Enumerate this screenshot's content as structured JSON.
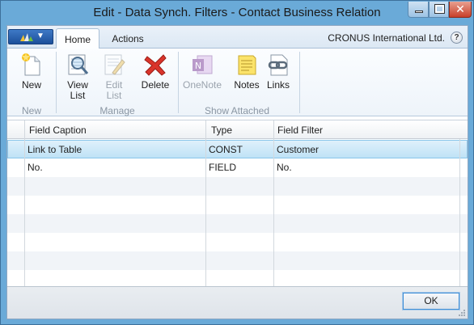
{
  "window": {
    "title": "Edit - Data Synch. Filters - Contact Business Relation"
  },
  "ribbon_tabs": [
    {
      "label": "Home"
    },
    {
      "label": "Actions"
    }
  ],
  "company": "CRONUS International Ltd.",
  "help_label": "?",
  "ribbon": {
    "new_group": {
      "label": "New",
      "new_label": "New"
    },
    "manage_group": {
      "label": "Manage",
      "view_list_label": "View\nList",
      "edit_list_label": "Edit\nList",
      "delete_label": "Delete"
    },
    "attached_group": {
      "label": "Show Attached",
      "onenote_label": "OneNote",
      "notes_label": "Notes",
      "links_label": "Links"
    }
  },
  "grid": {
    "columns": [
      "Field Caption",
      "Type",
      "Field Filter"
    ],
    "rows": [
      {
        "field_caption": "Link to Table",
        "type": "CONST",
        "field_filter": "Customer",
        "selected": true
      },
      {
        "field_caption": "No.",
        "type": "FIELD",
        "field_filter": "No.",
        "selected": false
      }
    ]
  },
  "footer": {
    "ok_label": "OK"
  },
  "colors": {
    "title_bar": "#6aaad8",
    "selected_row": "#bfe2f6",
    "delete_icon": "#d9342b",
    "app_button": "#2b62b4"
  }
}
